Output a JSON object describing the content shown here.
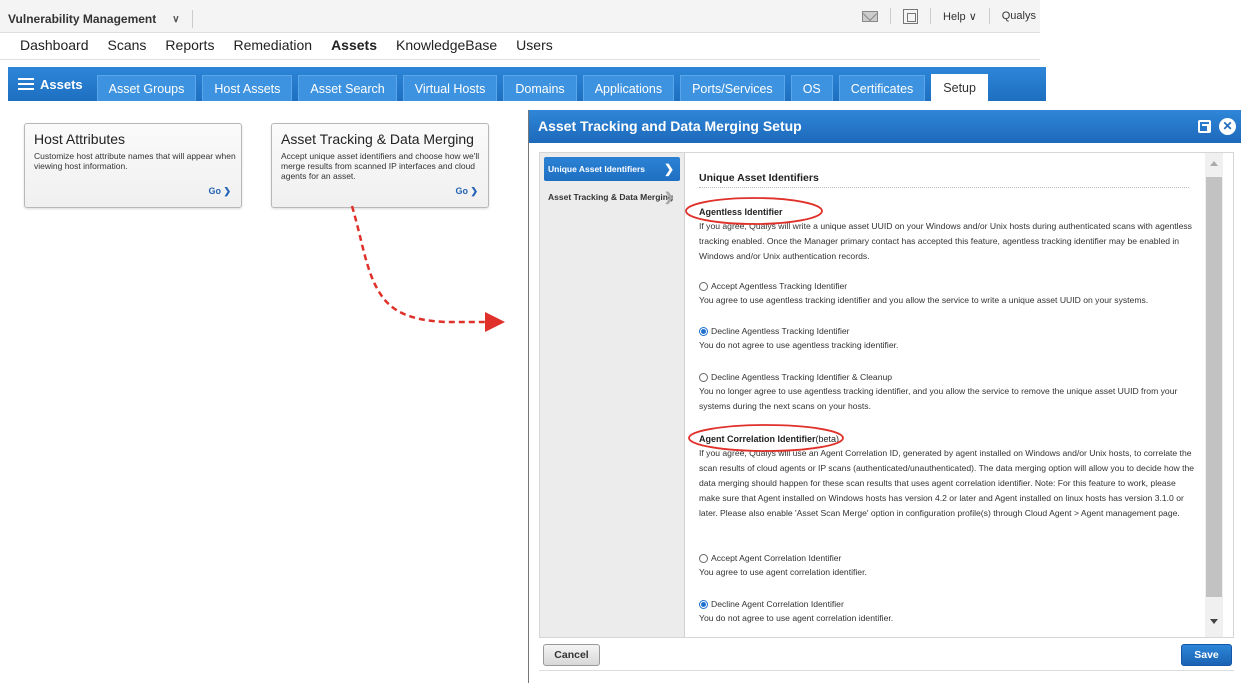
{
  "topbar": {
    "app_name": "Vulnerability Management",
    "help_label": "Help",
    "brand_label": "Qualys"
  },
  "main_nav": [
    "Dashboard",
    "Scans",
    "Reports",
    "Remediation",
    "Assets",
    "KnowledgeBase",
    "Users"
  ],
  "main_nav_active": "Assets",
  "tabs": {
    "section_label": "Assets",
    "items": [
      "Asset Groups",
      "Host Assets",
      "Asset Search",
      "Virtual Hosts",
      "Domains",
      "Applications",
      "Ports/Services",
      "OS",
      "Certificates",
      "Setup"
    ],
    "active": "Setup"
  },
  "cards": [
    {
      "title": "Host Attributes",
      "description": "Customize host attribute names that will appear when viewing host information.",
      "go_label": "Go"
    },
    {
      "title": "Asset Tracking & Data Merging",
      "description": "Accept unique asset identifiers and choose how we'll merge results from scanned IP interfaces and cloud agents for an asset.",
      "go_label": "Go"
    }
  ],
  "dialog": {
    "title": "Asset Tracking and Data Merging Setup",
    "nav": [
      "Unique Asset Identifiers",
      "Asset Tracking & Data Merging"
    ],
    "section_title": "Unique Asset Identifiers",
    "agentless": {
      "title": "Agentless Identifier",
      "text": "If you agree, Qualys will write a unique asset UUID on your Windows and/or Unix hosts during authenticated scans with agentless tracking enabled. Once the Manager primary contact has accepted this feature, agentless tracking identifier may be enabled in Windows and/or Unix authentication records.",
      "options": [
        {
          "label": "Accept Agentless Tracking Identifier",
          "desc": "You agree to use agentless tracking identifier and you allow the service to write a unique asset UUID on your systems.",
          "selected": false
        },
        {
          "label": "Decline Agentless Tracking Identifier",
          "desc": "You do not agree to use agentless tracking identifier.",
          "selected": true
        },
        {
          "label": "Decline Agentless Tracking Identifier & Cleanup",
          "desc": "You no longer agree to use agentless tracking identifier, and you allow the service to remove the unique asset UUID from your systems during the next scans on your hosts.",
          "selected": false
        }
      ]
    },
    "agent_correlation": {
      "title": "Agent Correlation Identifier",
      "badge": "(beta)",
      "text": "If you agree, Qualys will use an Agent Correlation ID, generated by agent installed on Windows and/or Unix hosts, to correlate the scan results of cloud agents or IP scans (authenticated/unauthenticated). The data merging option will allow you to decide how the data merging should happen for these scan results that uses agent correlation identifier. Note: For this feature to work, please make sure that Agent installed on Windows hosts has version 4.2 or later and Agent installed on linux hosts has version 3.1.0 or later. Please also enable 'Asset Scan Merge' option in configuration profile(s) through Cloud Agent > Agent management page.",
      "options": [
        {
          "label": "Accept Agent Correlation Identifier",
          "desc": "You agree to use agent correlation identifier.",
          "selected": false
        },
        {
          "label": "Decline Agent Correlation Identifier",
          "desc": "You do not agree to use agent correlation identifier.",
          "selected": true
        }
      ]
    },
    "cancel_label": "Cancel",
    "save_label": "Save"
  },
  "colors": {
    "brand_blue": "#1e6fc0",
    "annotation_red": "#e0302a"
  }
}
